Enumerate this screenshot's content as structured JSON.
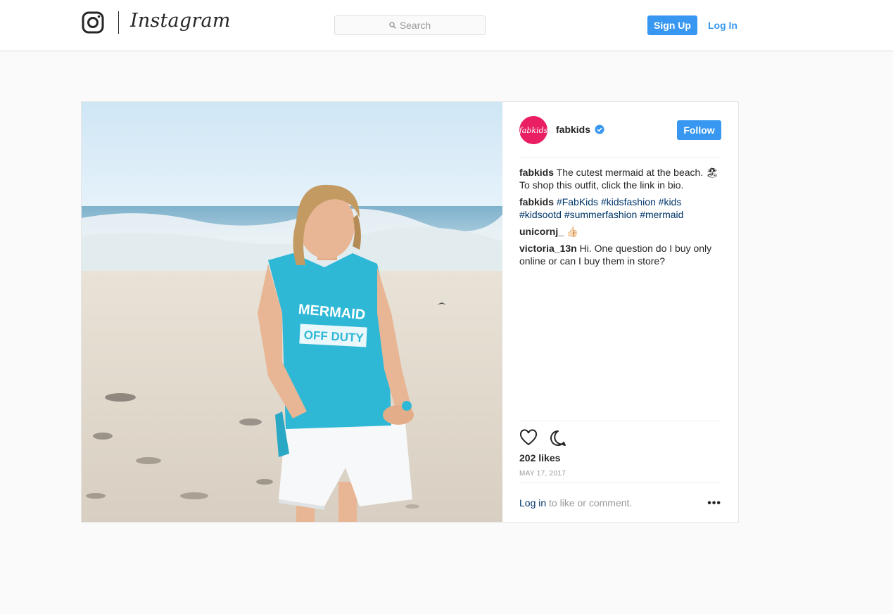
{
  "topbar": {
    "brand": "Instagram",
    "search_placeholder": "Search",
    "signup_label": "Sign Up",
    "login_label": "Log In",
    "accent_color": "#3897f0"
  },
  "post": {
    "image_alt": "Girl on beach wearing MERMAID OFF DUTY tank top",
    "shirt_text_line1": "MERMAID",
    "shirt_text_line2": "OFF DUTY",
    "author": {
      "username": "fabkids",
      "avatar_text": "fabkids",
      "verified": true,
      "follow_label": "Follow"
    },
    "comments": [
      {
        "user": "fabkids",
        "text": "The cutest mermaid at the beach. 🏖To shop this outfit, click the link in bio."
      },
      {
        "user": "fabkids",
        "hashtags": "#FabKids #kidsfashion #kids #kidsootd #summerfashion #mermaid"
      },
      {
        "user": "unicornj_",
        "text": "👍🏻"
      },
      {
        "user": "victoria_13n",
        "text": "Hi. One question do I buy only online or can I buy them in store?"
      }
    ],
    "likes": "202 likes",
    "date": "MAY 17, 2017",
    "login_link": "Log in",
    "login_suffix": " to like or comment.",
    "more_label": "•••",
    "icons": {
      "like": "heart-icon",
      "comment": "comment-icon",
      "more": "more-options-icon",
      "verified": "verified-badge-icon"
    }
  }
}
